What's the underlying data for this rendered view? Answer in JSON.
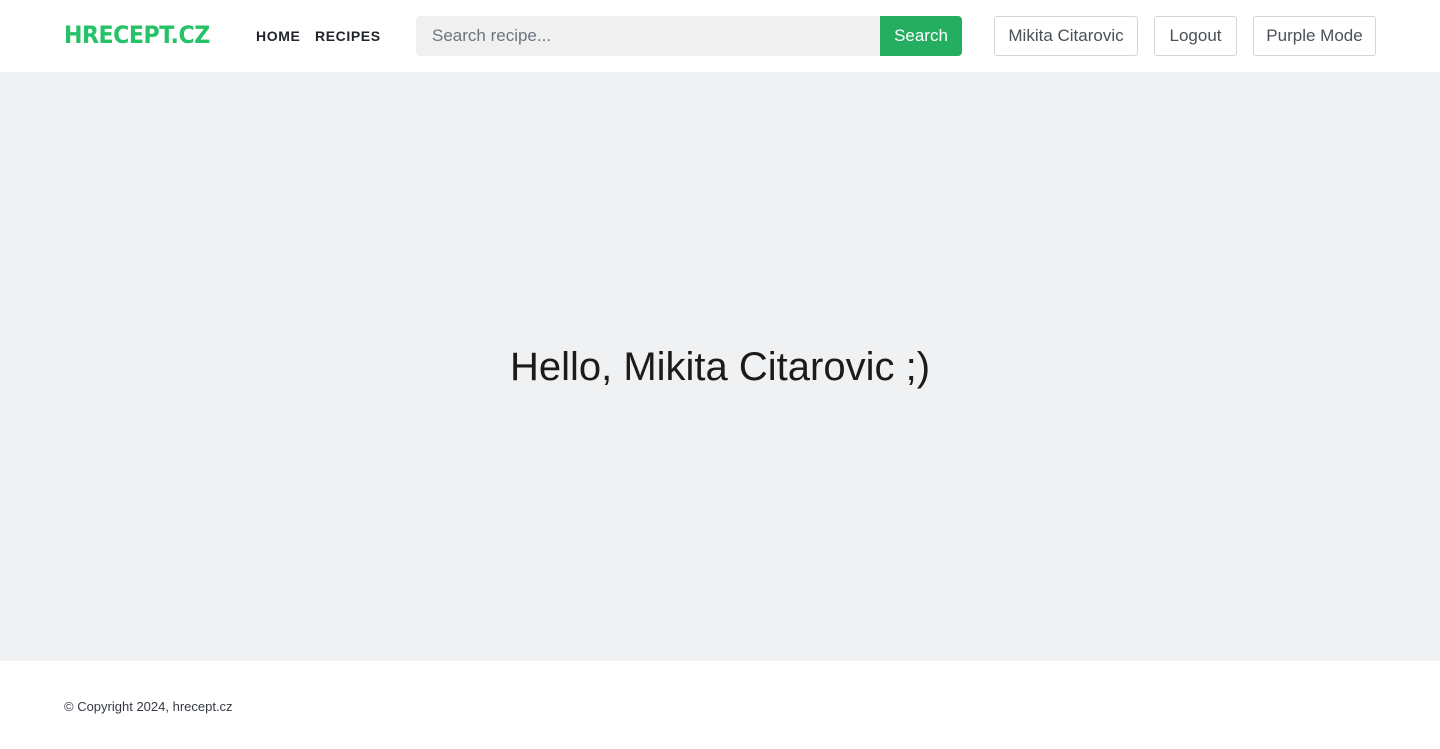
{
  "header": {
    "logo": "HRECEPT.CZ",
    "nav": {
      "home": "HOME",
      "recipes": "RECIPES"
    },
    "search": {
      "placeholder": "Search recipe...",
      "value": "",
      "button_label": "Search"
    },
    "user_button": "Mikita Citarovic",
    "logout_button": "Logout",
    "theme_button": "Purple Mode"
  },
  "main": {
    "greeting": "Hello, Mikita Citarovic ;)"
  },
  "footer": {
    "copyright": "© Copyright 2024, hrecept.cz"
  },
  "colors": {
    "brand": "#26c268",
    "search_button": "#26ae60",
    "main_background": "#f0f1f2"
  }
}
